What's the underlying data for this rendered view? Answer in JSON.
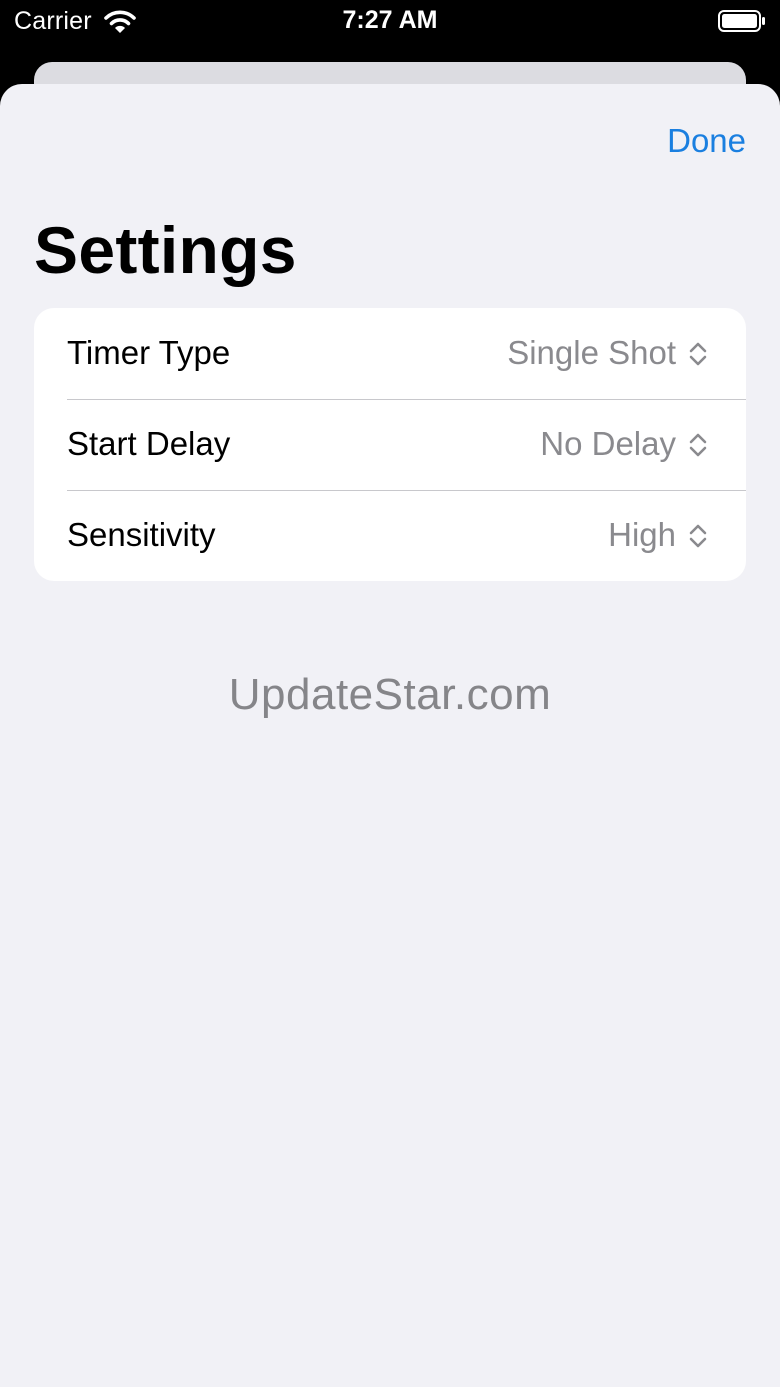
{
  "status_bar": {
    "carrier": "Carrier",
    "time": "7:27 AM"
  },
  "navigation": {
    "done_label": "Done",
    "title": "Settings"
  },
  "settings": [
    {
      "label": "Timer Type",
      "value": "Single Shot"
    },
    {
      "label": "Start Delay",
      "value": "No Delay"
    },
    {
      "label": "Sensitivity",
      "value": "High"
    }
  ],
  "watermark": "UpdateStar.com",
  "icons": {
    "wifi": "wifi-icon",
    "battery": "battery-icon",
    "row_selector": "chevron-up-down-icon"
  },
  "colors": {
    "accent": "#1a7fe0",
    "background": "#f1f1f6",
    "secondary_text": "#8a8a8e"
  }
}
